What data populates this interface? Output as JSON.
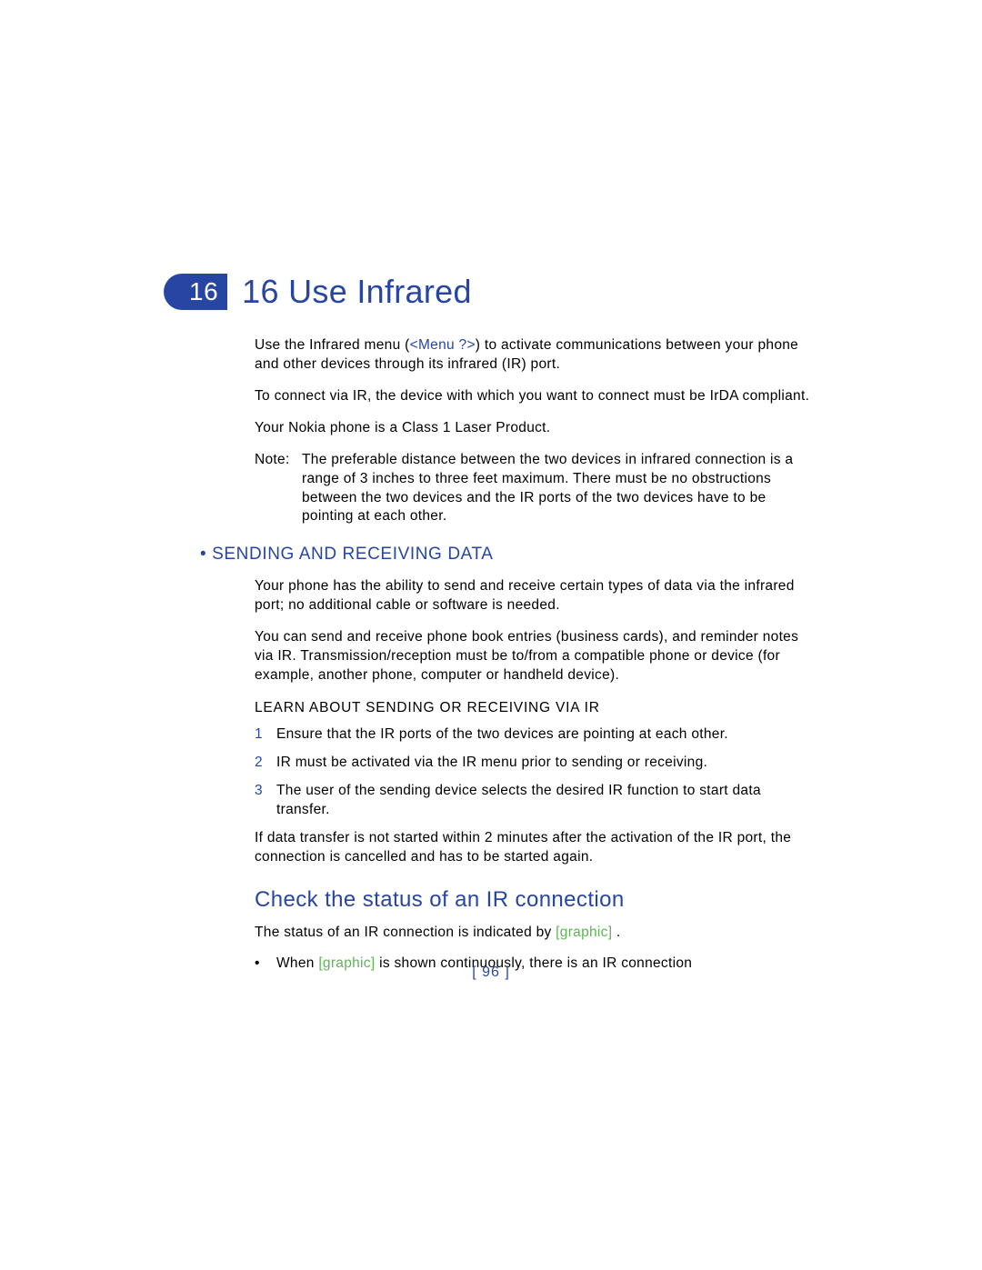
{
  "chapter": {
    "tab_number": "16",
    "title": "16  Use Infrared"
  },
  "intro": {
    "p1_before": "Use the Infrared menu (",
    "p1_menu": "<Menu ?>",
    "p1_after": ") to activate communications between your phone and other devices through its infrared (IR) port.",
    "p2": "To connect via IR, the device with which you want to connect must be IrDA compliant.",
    "p3": "Your Nokia phone is a Class 1 Laser Product."
  },
  "note": {
    "label": "Note:",
    "text": "The preferable distance between the two devices in infrared connection is a range of 3 inches to three feet maximum. There must be no obstructions between the two devices and the IR ports of the two devices have to be pointing at each other."
  },
  "section1": {
    "heading": "•  SENDING AND RECEIVING DATA",
    "p1": "Your phone has the ability to send and receive certain types of data via the infrared port; no additional cable or software is needed.",
    "p2": "You can send and receive phone book entries (business cards), and reminder notes via IR. Transmission/reception must be to/from a compatible phone or device (for example, another phone, computer or handheld device).",
    "subheading": "LEARN ABOUT SENDING OR RECEIVING VIA IR",
    "items": [
      {
        "num": "1",
        "text": "Ensure that the IR ports of the two devices are pointing at each other."
      },
      {
        "num": "2",
        "text": "IR must be activated via the IR menu prior to sending or receiving."
      },
      {
        "num": "3",
        "text": "The user of the sending device selects the desired IR function to start data transfer."
      }
    ],
    "p3": "If data transfer is not started within 2 minutes after the activation of the IR port, the connection is cancelled and has to be started again."
  },
  "section2": {
    "heading": "Check the status of an IR connection",
    "status_before": "The status of an IR connection is indicated by ",
    "graphic": "[graphic]",
    "status_after": "  .",
    "bullet_before": "When ",
    "bullet_graphic": "[graphic]",
    "bullet_after": " is shown continuously, there is an IR connection"
  },
  "footer": "[ 96 ]"
}
